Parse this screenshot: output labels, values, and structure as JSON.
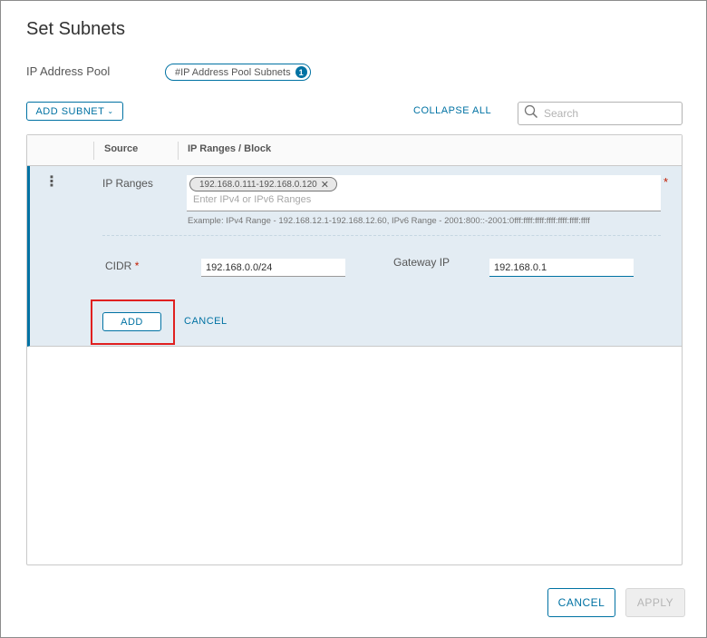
{
  "dialog": {
    "title": "Set Subnets",
    "pool_label": "IP Address Pool",
    "pool_chip_label": "#IP Address Pool Subnets",
    "pool_chip_count": "1"
  },
  "toolbar": {
    "add_subnet_label": "ADD SUBNET",
    "collapse_all_label": "COLLAPSE ALL",
    "search_placeholder": "Search"
  },
  "grid": {
    "columns": [
      "Source",
      "IP Ranges / Block"
    ],
    "row": {
      "ip_ranges_label": "IP Ranges",
      "ip_range_chip": "192.168.0.111-192.168.0.120",
      "ip_ranges_placeholder": "Enter IPv4 or IPv6 Ranges",
      "required_mark": "*",
      "example_text": "Example: IPv4 Range - 192.168.12.1-192.168.12.60, IPv6 Range - 2001:800::-2001:0fff:ffff:ffff:ffff:ffff:ffff:ffff",
      "cidr_label": "CIDR",
      "cidr_value": "192.168.0.0/24",
      "gateway_label": "Gateway IP",
      "gateway_value": "192.168.0.1",
      "add_label": "ADD",
      "cancel_label": "CANCEL"
    }
  },
  "footer": {
    "cancel_label": "CANCEL",
    "apply_label": "APPLY"
  },
  "colors": {
    "accent": "#0072a3",
    "row_background": "#e3ecf3",
    "highlight_box": "#e02020",
    "required": "#c21d00"
  }
}
